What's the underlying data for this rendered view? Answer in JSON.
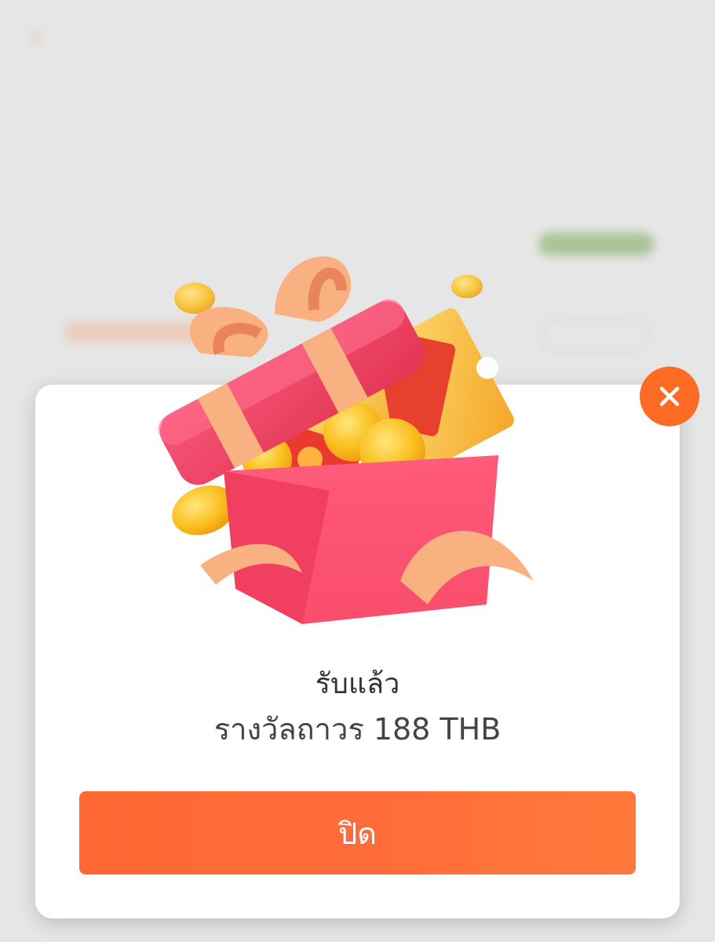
{
  "background": {
    "back_icon": "arrow-left-icon",
    "title": "",
    "tab": ""
  },
  "modal": {
    "line1": "รับแล้ว",
    "line2": "รางวัลถาวร 188 THB",
    "close_button_label": "ปิด",
    "close_icon": "close-icon",
    "illustration": "gift-box-with-coins-and-tickets"
  },
  "colors": {
    "accent": "#ff6a25",
    "button": "#ff6b35",
    "gift_box": "#f2506b",
    "ribbon": "#f8b27c",
    "coin": "#f7b51f"
  }
}
